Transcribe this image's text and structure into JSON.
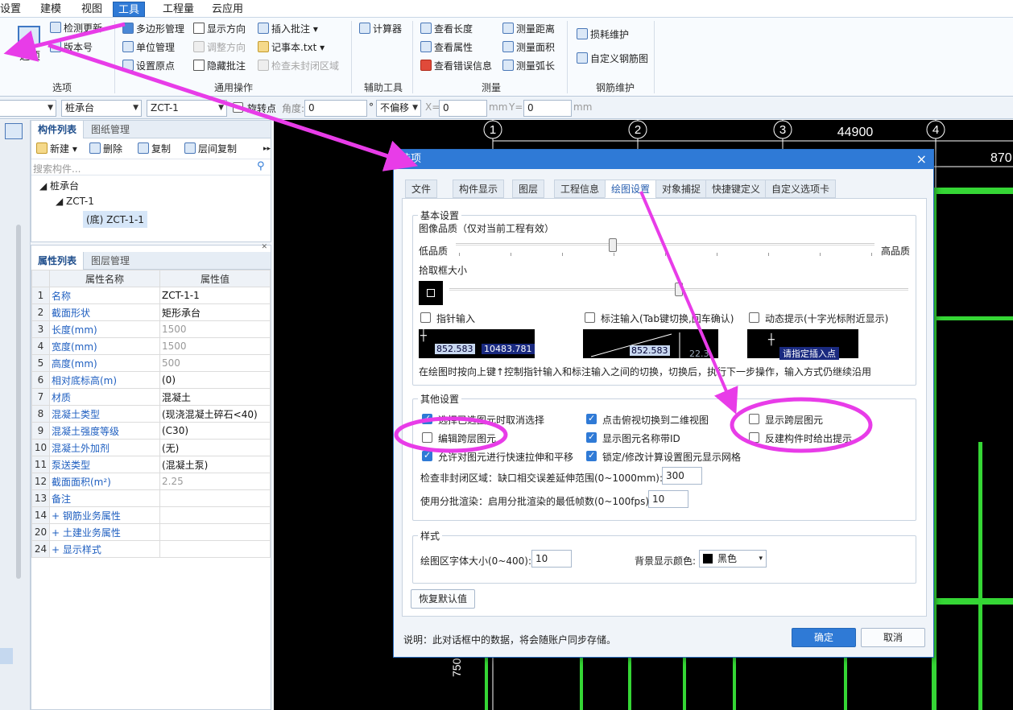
{
  "menu": {
    "items": [
      "设置",
      "建模",
      "视图",
      "工具",
      "工程量",
      "云应用"
    ],
    "active": "工具"
  },
  "ribbon": {
    "options_label": "选项",
    "check_update": "检测更新",
    "version": "版本号",
    "polygon_mgmt": "多边形管理",
    "unit_mgmt": "单位管理",
    "set_origin": "设置原点",
    "show_direction": "显示方向",
    "adjust_direction": "调整方向",
    "hide_annotation": "隐藏批注",
    "insert_annotation": "插入批注",
    "notepad": "记事本.txt",
    "check_unclosed": "检查未封闭区域",
    "calculator": "计算器",
    "view_length": "查看长度",
    "view_attr": "查看属性",
    "view_errors": "查看错误信息",
    "measure_distance": "测量距离",
    "measure_area": "测量面积",
    "measure_arc": "测量弧长",
    "loss_maintenance": "损耗维护",
    "custom_rebar": "自定义钢筋图",
    "groups": [
      "选项",
      "通用操作",
      "辅助工具",
      "测量",
      "钢筋维护"
    ]
  },
  "toolbar2": {
    "combo_type": "桩承台",
    "combo_name": "ZCT-1",
    "rotate_point": "旋转点",
    "angle_label": "角度:",
    "angle_value": "0",
    "degree": "°",
    "offset": "不偏移",
    "x_label": "X=",
    "x_value": "0",
    "y_label": "Y=",
    "y_value": "0",
    "mm": "mm"
  },
  "component_panel": {
    "tabs": [
      "构件列表",
      "图纸管理"
    ],
    "new": "新建",
    "delete": "删除",
    "copy": "复制",
    "floor_copy": "层间复制",
    "search_placeholder": "搜索构件...",
    "tree": [
      "桩承台",
      "ZCT-1",
      "(底) ZCT-1-1"
    ]
  },
  "property_panel": {
    "tabs": [
      "属性列表",
      "图层管理"
    ],
    "header": [
      "属性名称",
      "属性值"
    ],
    "rows": [
      {
        "n": "1",
        "k": "名称",
        "v": "ZCT-1-1",
        "grey": false
      },
      {
        "n": "2",
        "k": "截面形状",
        "v": "矩形承台",
        "grey": false
      },
      {
        "n": "3",
        "k": "长度(mm)",
        "v": "1500",
        "grey": true
      },
      {
        "n": "4",
        "k": "宽度(mm)",
        "v": "1500",
        "grey": true
      },
      {
        "n": "5",
        "k": "高度(mm)",
        "v": "500",
        "grey": true
      },
      {
        "n": "6",
        "k": "相对底标高(m)",
        "v": "(0)",
        "grey": false
      },
      {
        "n": "7",
        "k": "材质",
        "v": "混凝土",
        "grey": false
      },
      {
        "n": "8",
        "k": "混凝土类型",
        "v": "(现浇混凝土碎石<40)",
        "grey": false
      },
      {
        "n": "9",
        "k": "混凝土强度等级",
        "v": "(C30)",
        "grey": false
      },
      {
        "n": "10",
        "k": "混凝土外加剂",
        "v": "(无)",
        "grey": false
      },
      {
        "n": "11",
        "k": "泵送类型",
        "v": "(混凝土泵)",
        "grey": false
      },
      {
        "n": "12",
        "k": "截面面积(m²)",
        "v": "2.25",
        "grey": true
      },
      {
        "n": "13",
        "k": "备注",
        "v": "",
        "grey": false
      },
      {
        "n": "14",
        "k": "+ 钢筋业务属性",
        "v": "",
        "grey": false
      },
      {
        "n": "20",
        "k": "+ 土建业务属性",
        "v": "",
        "grey": false
      },
      {
        "n": "24",
        "k": "+ 显示样式",
        "v": "",
        "grey": false
      }
    ]
  },
  "canvas": {
    "axis": [
      "1",
      "2",
      "3",
      "4"
    ],
    "dim_top": "44900",
    "dim_right": "870",
    "dim_left": "750"
  },
  "dialog": {
    "title": "选项",
    "tabs": [
      "文件",
      "构件显示",
      "图层",
      "工程信息",
      "绘图设置",
      "对象捕捉",
      "快捷键定义",
      "自定义选项卡"
    ],
    "active_tab": "绘图设置",
    "basic": {
      "legend": "基本设置",
      "quality_label": "图像品质（仅对当前工程有效）",
      "low": "低品质",
      "high": "高品质",
      "pickbox_label": "拾取框大小",
      "pointer_input": "指针输入",
      "dim_input": "标注输入(Tab键切换,回车确认)",
      "dynamic_hint": "动态提示(十字光标附近显示)",
      "demo1_a": "852.583",
      "demo1_b": "10483.781",
      "demo2": "852.583",
      "demo2_b": "22.3",
      "demo3": "请指定插入点",
      "note": "在绘图时按向上键↑控制指针输入和标注输入之间的切换，切换后，执行下一步操作，输入方式仍继续沿用"
    },
    "other": {
      "legend": "其他设置",
      "c1": "选择已选图元时取消选择",
      "c2": "点击俯视切换到二维视图",
      "c3": "显示跨层图元",
      "c4": "编辑跨层图元",
      "c5": "显示图元名称带ID",
      "c6": "反建构件时给出提示",
      "c7": "允许对图元进行快速拉伸和平移",
      "c8": "锁定/修改计算设置图元显示网格",
      "gap_label": "检查非封闭区域：缺口相交误差延伸范围(0~1000mm):",
      "gap_value": "300",
      "batch_label": "使用分批渲染：启用分批渲染的最低帧数(0~100fps):",
      "batch_value": "10"
    },
    "style": {
      "legend": "样式",
      "font_label": "绘图区字体大小(0~400):",
      "font_value": "10",
      "bg_label": "背景显示颜色:",
      "bg_value": "黑色"
    },
    "restore": "恢复默认值",
    "footer_note": "说明：此对话框中的数据，将会随账户同步存储。",
    "ok": "确定",
    "cancel": "取消"
  },
  "colors": {
    "accent": "#2f7ad6",
    "annotation": "#e83ce8",
    "grid_line": "#35d635"
  }
}
